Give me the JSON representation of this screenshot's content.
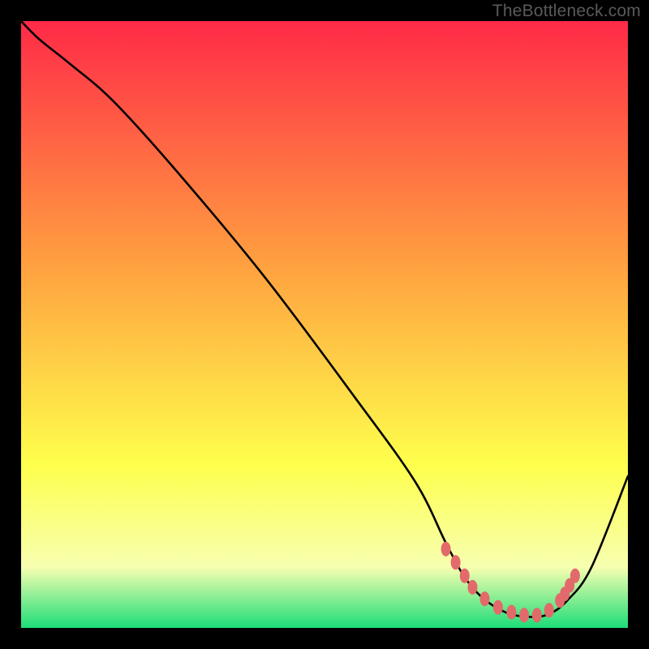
{
  "watermark": "TheBottleneck.com",
  "colors": {
    "red": "#ff2a47",
    "orange": "#ffa340",
    "yellow": "#feff4c",
    "paleyellow": "#f7ffb0",
    "green": "#1cdd78",
    "black": "#000000",
    "curve": "#000000",
    "dotted": "#e36a6a"
  },
  "chart_data": {
    "type": "line",
    "title": "",
    "xlabel": "",
    "ylabel": "",
    "xlim": [
      0,
      100
    ],
    "ylim": [
      0,
      100
    ],
    "series": [
      {
        "name": "bottleneck-curve",
        "x": [
          0,
          3,
          8,
          15,
          25,
          40,
          55,
          65,
          70,
          73,
          76,
          80,
          84,
          87,
          90,
          94,
          100
        ],
        "y": [
          100,
          97,
          93,
          87,
          76,
          58,
          38,
          24,
          14,
          8.5,
          5,
          2.5,
          1.8,
          2.3,
          4.5,
          10,
          25
        ]
      }
    ],
    "highlight_zone": {
      "name": "optimal-range-dots",
      "points": [
        {
          "x": 70.0,
          "y": 13.0
        },
        {
          "x": 71.6,
          "y": 10.8
        },
        {
          "x": 73.1,
          "y": 8.6
        },
        {
          "x": 74.4,
          "y": 6.7
        },
        {
          "x": 76.4,
          "y": 4.8
        },
        {
          "x": 78.6,
          "y": 3.4
        },
        {
          "x": 80.8,
          "y": 2.6
        },
        {
          "x": 82.9,
          "y": 2.1
        },
        {
          "x": 85.0,
          "y": 2.1
        },
        {
          "x": 87.0,
          "y": 2.9
        },
        {
          "x": 88.8,
          "y": 4.5
        },
        {
          "x": 89.6,
          "y": 5.6
        },
        {
          "x": 90.4,
          "y": 7.0
        },
        {
          "x": 91.3,
          "y": 8.6
        }
      ]
    }
  }
}
